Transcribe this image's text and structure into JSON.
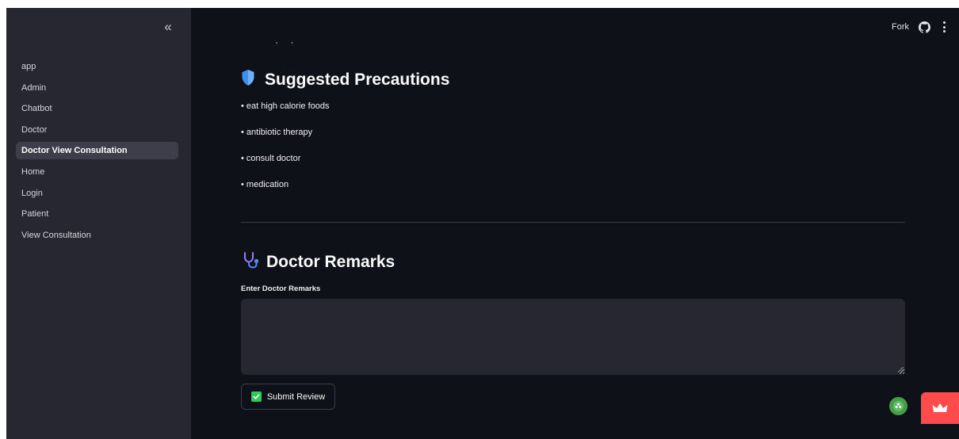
{
  "sidebar": {
    "collapse_glyph": "«",
    "items": [
      {
        "label": "app",
        "active": false
      },
      {
        "label": "Admin",
        "active": false
      },
      {
        "label": "Chatbot",
        "active": false
      },
      {
        "label": "Doctor",
        "active": false
      },
      {
        "label": "Doctor View Consultation",
        "active": true
      },
      {
        "label": "Home",
        "active": false
      },
      {
        "label": "Login",
        "active": false
      },
      {
        "label": "Patient",
        "active": false
      },
      {
        "label": "View Consultation",
        "active": false
      }
    ]
  },
  "toolbar": {
    "fork_label": "Fork",
    "icons": [
      "github-icon",
      "kebab-menu-icon"
    ]
  },
  "main": {
    "clipped_text": "~ ~ ~ , ~ ,",
    "precautions": {
      "heading": "Suggested Precautions",
      "icon": "shield-icon",
      "items": [
        "• eat high calorie foods",
        "• antibiotic therapy",
        "• consult doctor",
        "• medication"
      ]
    },
    "remarks": {
      "heading": "Doctor Remarks",
      "icon": "stethoscope-icon",
      "input_label": "Enter Doctor Remarks",
      "input_value": "",
      "submit_label": "Submit Review"
    }
  },
  "colors": {
    "app_background": "#0e1117",
    "sidebar_background": "#262730",
    "input_background": "#262730",
    "accent_red": "#ff4b4b",
    "check_green": "#34c759",
    "shield_blue": "#3d8ef5"
  }
}
